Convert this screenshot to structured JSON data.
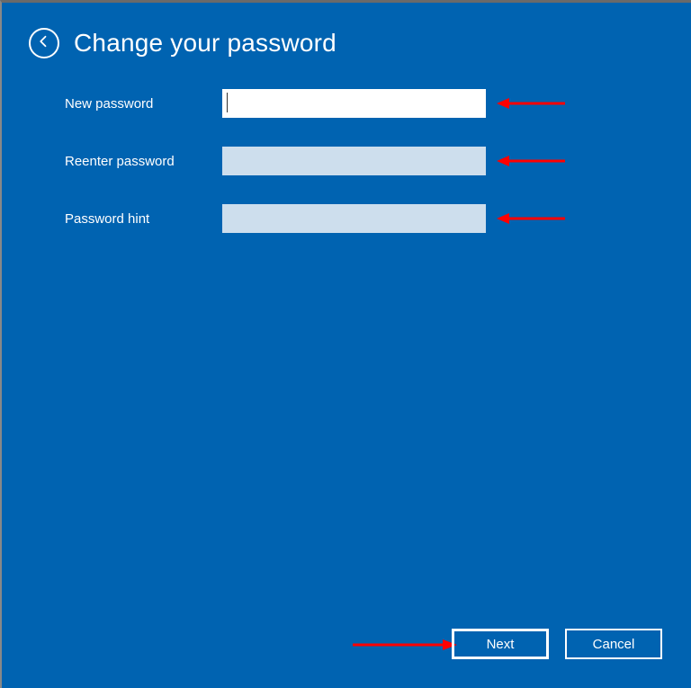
{
  "header": {
    "title": "Change your password"
  },
  "fields": {
    "new_password": {
      "label": "New password",
      "value": ""
    },
    "reenter_password": {
      "label": "Reenter password",
      "value": ""
    },
    "password_hint": {
      "label": "Password hint",
      "value": ""
    }
  },
  "buttons": {
    "next": "Next",
    "cancel": "Cancel"
  },
  "annotations": {
    "arrow_color": "#ff0000"
  }
}
